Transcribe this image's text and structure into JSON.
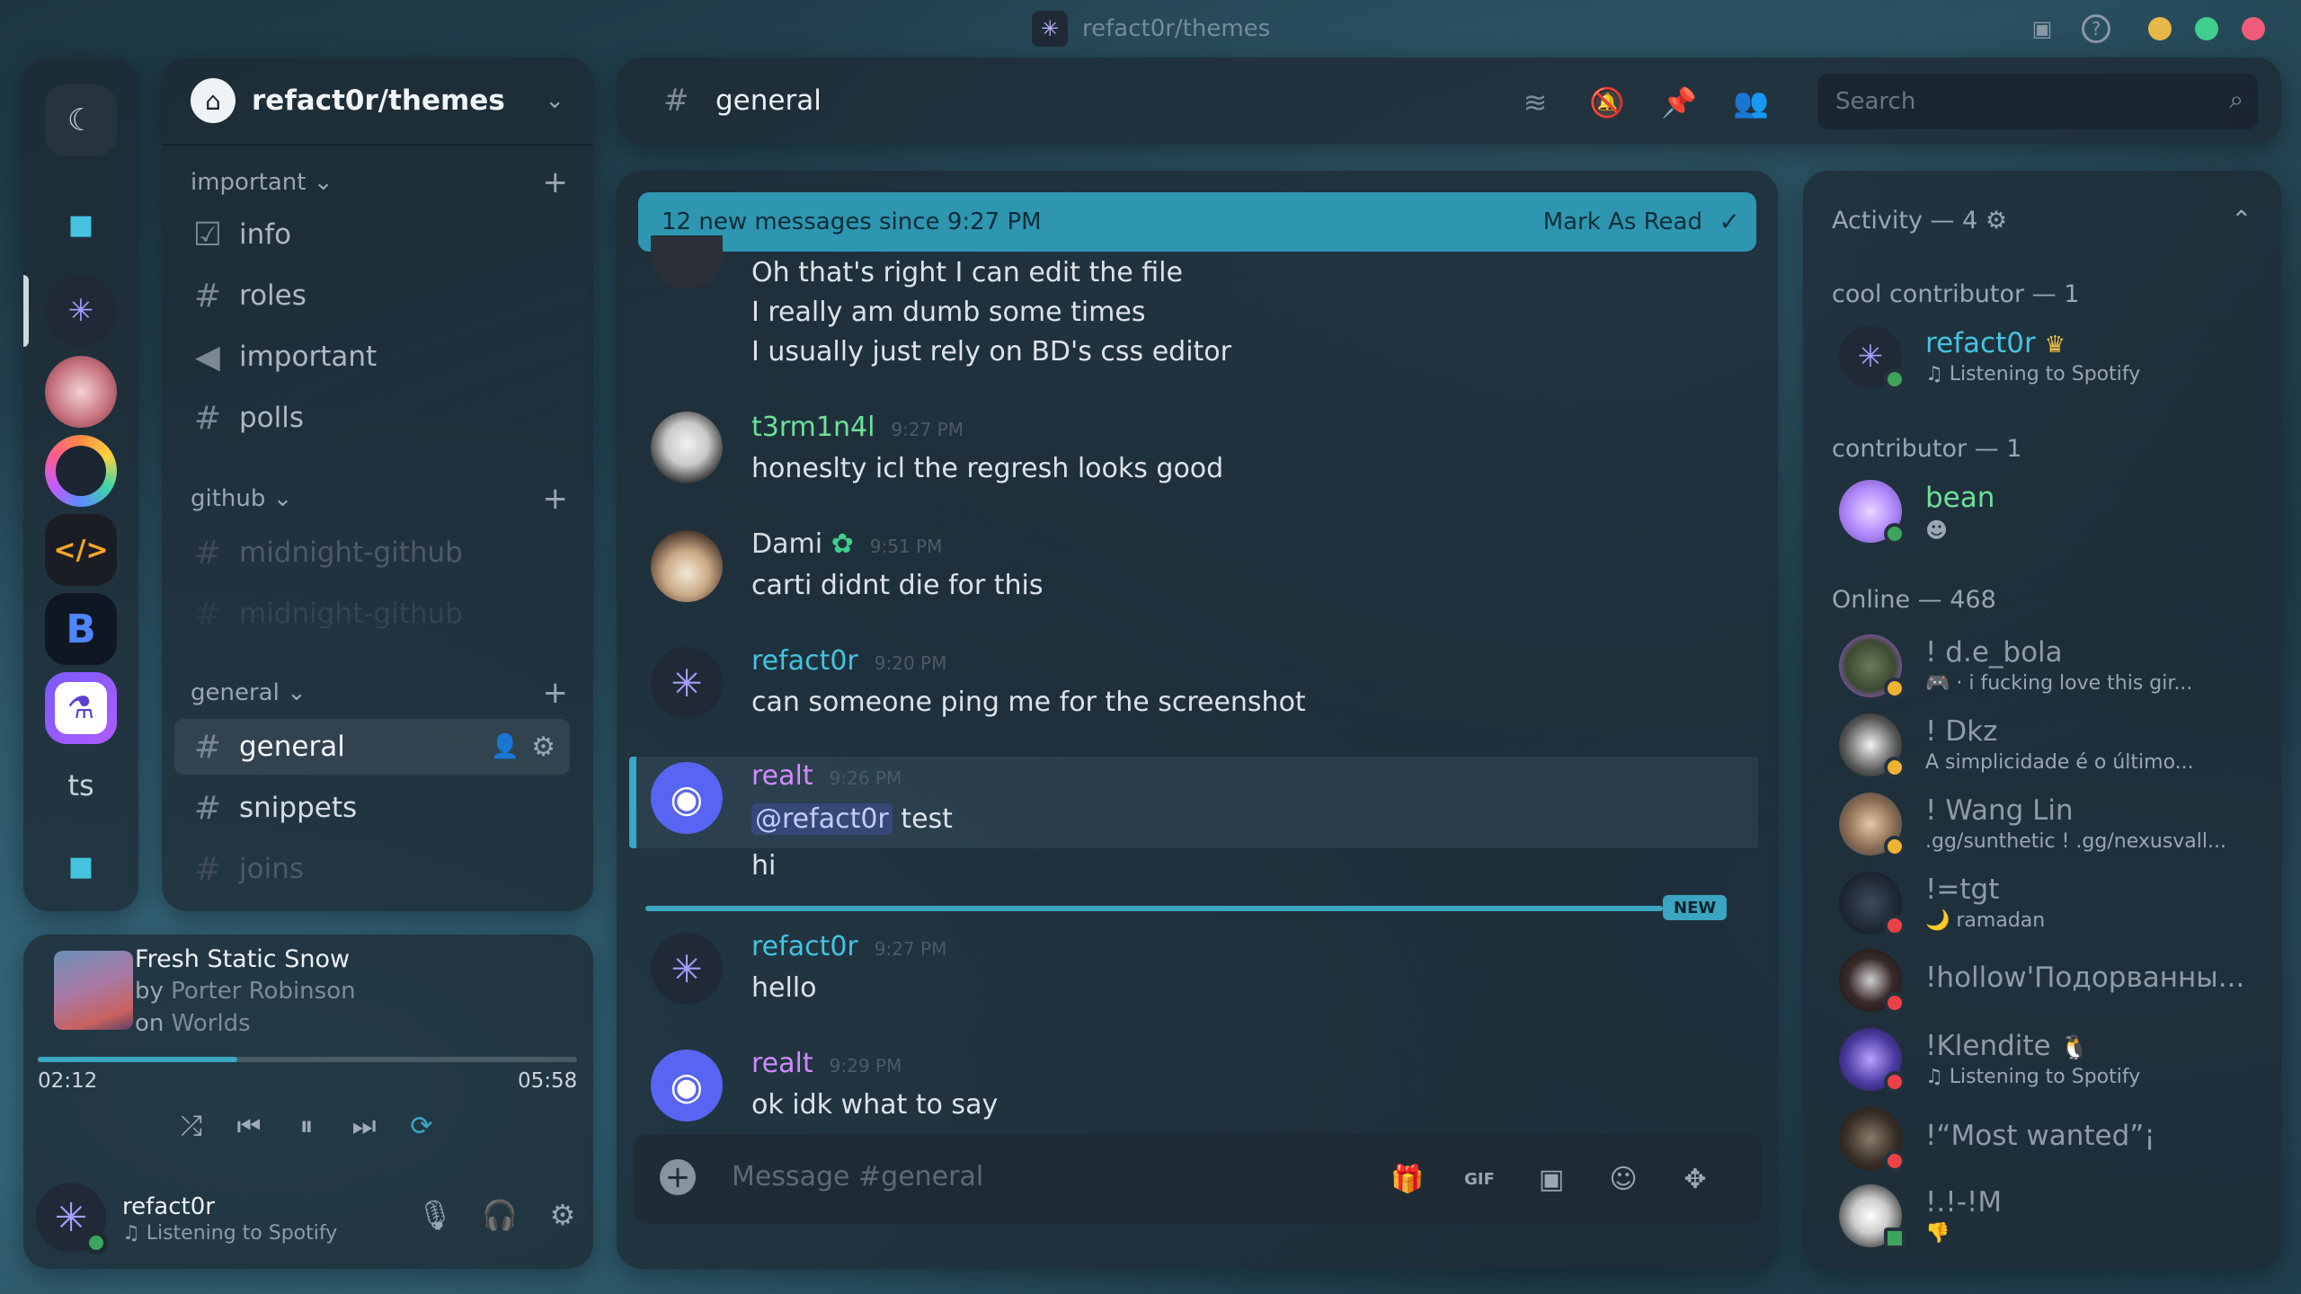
{
  "titlebar": {
    "title": "refact0r/themes",
    "logo_icon": "asterisk-icon"
  },
  "rail": {
    "servers": [
      "moon",
      "folder",
      "refact0r",
      "avatar1",
      "avatar2",
      "code",
      "b",
      "flask",
      "ts",
      "folder2"
    ],
    "ts_label": "ts"
  },
  "channels": {
    "server_name": "refact0r/themes",
    "categories": [
      {
        "name": "important ⌄",
        "channels": [
          {
            "name": "info",
            "type": "rules"
          },
          {
            "name": "roles",
            "type": "text"
          },
          {
            "name": "important",
            "type": "announce"
          },
          {
            "name": "polls",
            "type": "text"
          }
        ]
      },
      {
        "name": "github ⌄",
        "channels": [
          {
            "name": "midnight-github",
            "type": "text"
          },
          {
            "name": "midnight-github",
            "type": "text"
          }
        ]
      },
      {
        "name": "general ⌄",
        "channels": [
          {
            "name": "general",
            "type": "text"
          },
          {
            "name": "snippets",
            "type": "text"
          },
          {
            "name": "joins",
            "type": "text"
          }
        ]
      }
    ]
  },
  "player": {
    "title": "Fresh Static Snow",
    "by_prefix": "by ",
    "artist": "Porter Robinson",
    "on_prefix": "on ",
    "album": "Worlds",
    "elapsed": "02:12",
    "duration": "05:58",
    "progress_fraction": 0.37
  },
  "user": {
    "name": "refact0r",
    "status": "♫ Listening to Spotify"
  },
  "chat_header": {
    "channel": "general",
    "search_placeholder": "Search"
  },
  "banner": {
    "text": "12 new messages since 9:27 PM",
    "mark_label": "Mark As Read"
  },
  "messages": [
    {
      "lines": [
        "Oh that's right I can edit the file",
        "I really am dumb some times",
        "I usually just rely on BD's css editor"
      ]
    },
    {
      "author": "t3rm1n4l",
      "time": "9:27 PM",
      "text": "honeslty icl the regresh looks good",
      "color": "#6ee09a"
    },
    {
      "author": "Dami",
      "time": "9:51 PM",
      "text": "carti didnt die for this",
      "color": "#d7dde3"
    },
    {
      "author": "refact0r",
      "time": "9:20 PM",
      "text": "can someone ping me for the screenshot",
      "color": "#45c3e0"
    },
    {
      "author": "realt",
      "time": "9:26 PM",
      "mention": "@refact0r",
      "text": " test",
      "text2": "hi",
      "color": "#d08bff"
    },
    {
      "author": "refact0r",
      "time": "9:27 PM",
      "text": "hello",
      "color": "#45c3e0"
    },
    {
      "author": "realt",
      "time": "9:29 PM",
      "text": "ok idk what to say",
      "color": "#d08bff"
    }
  ],
  "new_label": "NEW",
  "composer": {
    "placeholder": "Message #general"
  },
  "members": {
    "activity_header": "Activity — 4",
    "sections": [
      {
        "title": "cool contributor — 1"
      },
      {
        "title": "contributor — 1"
      },
      {
        "title": "Online — 468"
      }
    ],
    "list": [
      {
        "name": "refact0r",
        "activity": "♫ Listening to Spotify",
        "color": "#45c3e0"
      },
      {
        "name": "bean",
        "activity": "",
        "color": "#6ee09a"
      },
      {
        "name": "! d.e_bola",
        "activity": "· i fucking love this gir...",
        "color": "#8f9ba6"
      },
      {
        "name": "! Dkz",
        "activity": "A simplicidade é o último...",
        "color": "#8f9ba6"
      },
      {
        "name": "! Wang Lin",
        "activity": ".gg/sunthetic ! .gg/nexusvall...",
        "color": "#8f9ba6"
      },
      {
        "name": "!=tgt",
        "activity": "🌙 ramadan",
        "color": "#8f9ba6"
      },
      {
        "name": "!hollow'Подорванны...",
        "activity": "",
        "color": "#8f9ba6"
      },
      {
        "name": "!Klendite",
        "activity": "♫ Listening to Spotify",
        "color": "#8f9ba6"
      },
      {
        "name": "!“Most wanted”¡",
        "activity": "",
        "color": "#8f9ba6"
      },
      {
        "name": "!.!-!M",
        "activity": "👎",
        "color": "#8f9ba6"
      }
    ]
  }
}
